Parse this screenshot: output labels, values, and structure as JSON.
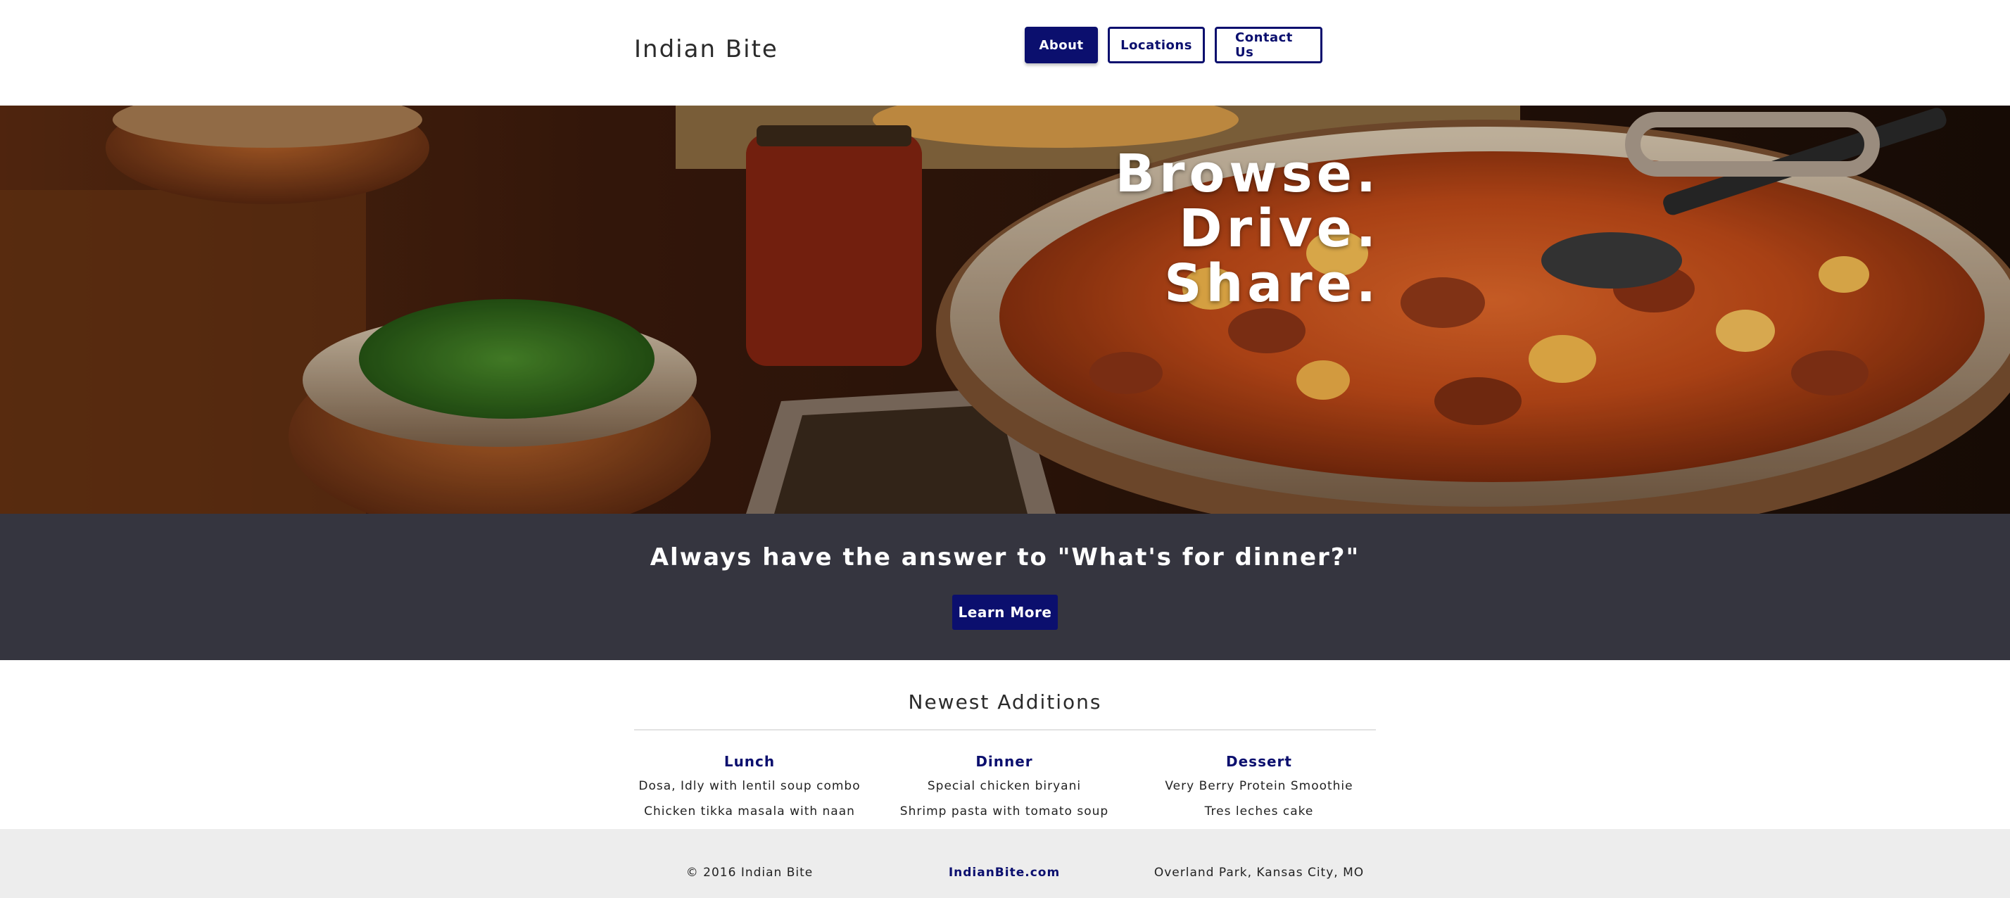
{
  "header": {
    "brand": "Indian Bite",
    "nav": [
      {
        "label": "About",
        "active": true
      },
      {
        "label": "Locations",
        "active": false
      },
      {
        "label": "Contact Us",
        "active": false
      }
    ]
  },
  "hero": {
    "lines": [
      "Browse.",
      "Drive.",
      "Share."
    ]
  },
  "band": {
    "title": "Always have the answer to \"What's for dinner?\"",
    "button_label": "Learn More"
  },
  "newest": {
    "title": "Newest Additions",
    "columns": [
      {
        "heading": "Lunch",
        "items": [
          "Dosa, Idly with lentil soup combo",
          "Chicken tikka masala with naan"
        ]
      },
      {
        "heading": "Dinner",
        "items": [
          "Special chicken biryani",
          "Shrimp pasta with tomato soup"
        ]
      },
      {
        "heading": "Dessert",
        "items": [
          "Very Berry Protein Smoothie",
          "Tres leches cake"
        ]
      }
    ]
  },
  "footer": {
    "copyright": "© 2016 Indian Bite",
    "site": "IndianBite.com",
    "location": "Overland Park, Kansas City, MO"
  },
  "colors": {
    "primary": "#0b0f6e",
    "band_bg": "#35353f",
    "footer_bg": "#ededed"
  }
}
